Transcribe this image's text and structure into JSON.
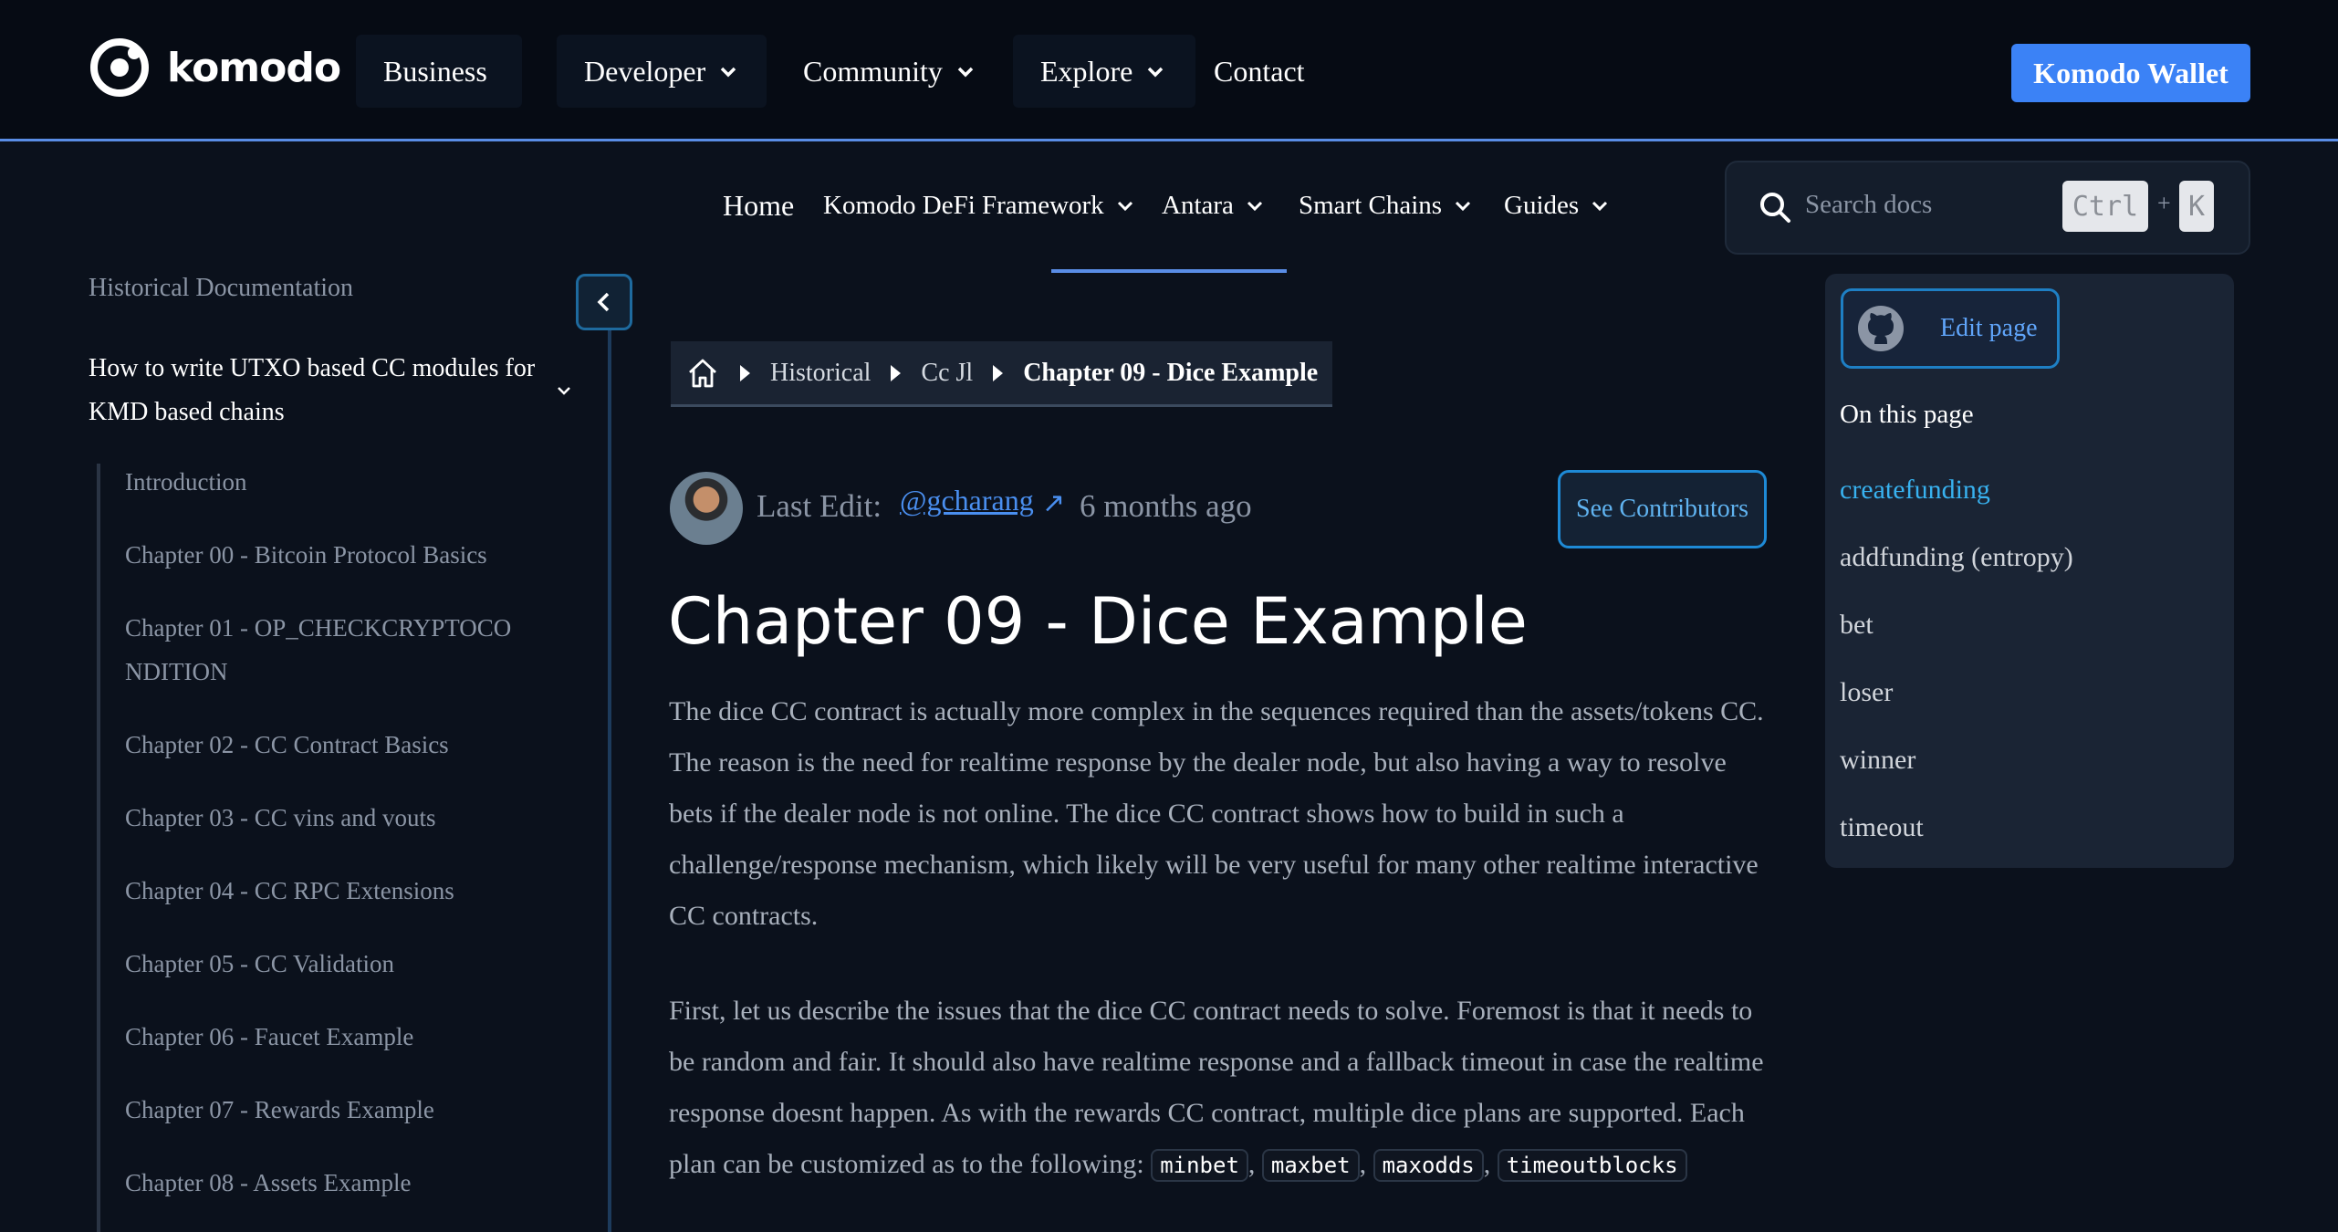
{
  "header": {
    "logo_text": "komodo",
    "nav": [
      {
        "label": "Business"
      },
      {
        "label": "Developer"
      },
      {
        "label": "Community"
      },
      {
        "label": "Explore"
      },
      {
        "label": "Contact"
      }
    ],
    "wallet_button": "Komodo Wallet"
  },
  "subnav": {
    "home": "Home",
    "items": [
      "Komodo DeFi Framework",
      "Antara",
      "Smart Chains",
      "Guides"
    ]
  },
  "search": {
    "placeholder": "Search docs",
    "shortcut_key1": "Ctrl",
    "shortcut_plus": "+",
    "shortcut_key2": "K"
  },
  "sidebar": {
    "title": "Historical Documentation",
    "section": "How to write UTXO based CC modules for KMD based chains",
    "items": [
      "Introduction",
      "Chapter 00 - Bitcoin Protocol Basics",
      "Chapter 01 - OP_CHECKCRYPTOCONDITION",
      "Chapter 02 - CC Contract Basics",
      "Chapter 03 - CC vins and vouts",
      "Chapter 04 - CC RPC Extensions",
      "Chapter 05 - CC Validation",
      "Chapter 06 - Faucet Example",
      "Chapter 07 - Rewards Example",
      "Chapter 08 - Assets Example"
    ]
  },
  "breadcrumb": {
    "items": [
      "Historical",
      "Cc Jl"
    ],
    "current": "Chapter 09 - Dice Example"
  },
  "last_edit": {
    "label": "Last Edit:",
    "author": "@gcharang",
    "arrow": "↗",
    "time": "6 months ago",
    "contributors_button": "See Contributors"
  },
  "content": {
    "title": "Chapter 09 - Dice Example",
    "para1": "The dice CC contract is actually more complex in the sequences required than the assets/tokens CC. The reason is the need for realtime response by the dealer node, but also having a way to resolve bets if the dealer node is not online. The dice CC contract shows how to build in such a challenge/response mechanism, which likely will be very useful for many other realtime interactive CC contracts.",
    "para2_text": "First, let us describe the issues that the dice CC contract needs to solve. Foremost is that it needs to be random and fair. It should also have realtime response and a fallback timeout in case the realtime response doesnt happen. As with the rewards CC contract, multiple dice plans are supported. Each plan can be customized as to the following: ",
    "codes": [
      "minbet",
      "maxbet",
      "maxodds",
      "timeoutblocks"
    ],
    "comma": ","
  },
  "toc": {
    "edit_page": "Edit page",
    "title": "On this page",
    "items": [
      "createfunding",
      "addfunding (entropy)",
      "bet",
      "loser",
      "winner",
      "timeout"
    ],
    "active_index": 0
  },
  "colors": {
    "background": "#0b111c",
    "accent": "#3b82f6",
    "link": "#4a8ff0",
    "toc_active": "#38b2f0"
  }
}
